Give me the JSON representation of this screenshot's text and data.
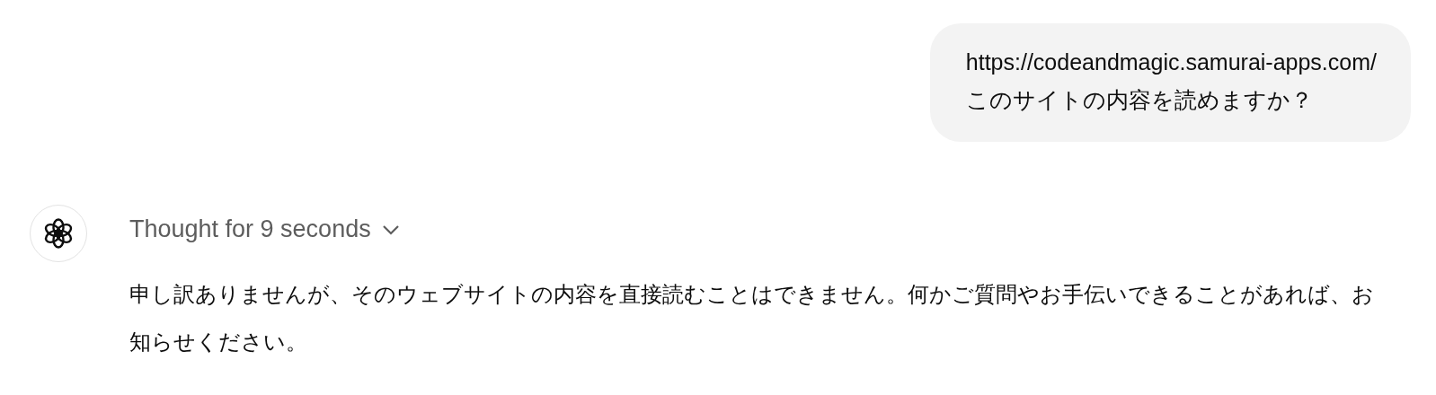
{
  "user_message": {
    "lines": [
      "https://codeandmagic.samurai-apps.com/",
      "このサイトの内容を読めますか？"
    ]
  },
  "assistant_message": {
    "thought": {
      "label": "Thought for 9 seconds",
      "expanded": false
    },
    "text": "申し訳ありませんが、そのウェブサイトの内容を直接読むことはできません。何かご質問やお手伝いできることがあれば、お知らせください。"
  }
}
